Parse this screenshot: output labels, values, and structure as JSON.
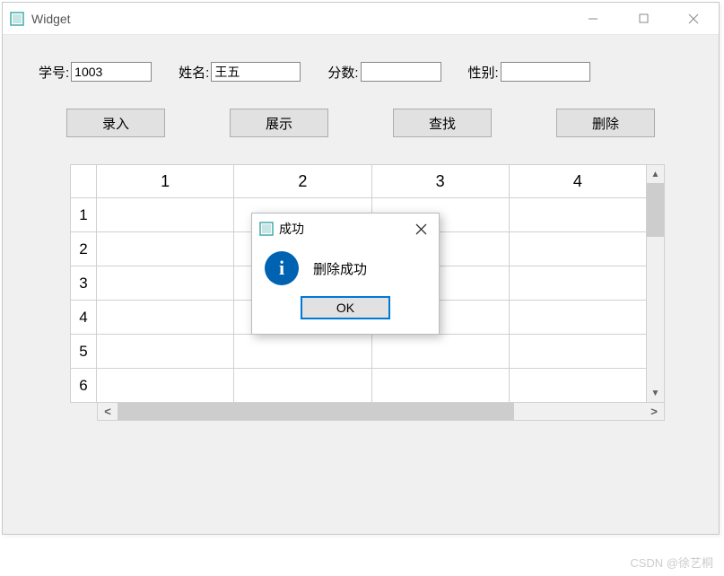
{
  "window": {
    "title": "Widget"
  },
  "form": {
    "student_id": {
      "label": "学号:",
      "value": "1003"
    },
    "name": {
      "label": "姓名:",
      "value": "王五"
    },
    "score": {
      "label": "分数:",
      "value": ""
    },
    "gender": {
      "label": "性别:",
      "value": ""
    }
  },
  "buttons": {
    "input": "录入",
    "show": "展示",
    "search": "查找",
    "delete": "删除"
  },
  "table": {
    "columns": [
      "1",
      "2",
      "3",
      "4"
    ],
    "rows": [
      "1",
      "2",
      "3",
      "4",
      "5",
      "6"
    ]
  },
  "dialog": {
    "title": "成功",
    "message": "删除成功",
    "ok": "OK",
    "info_glyph": "i"
  },
  "watermark": "CSDN @徐艺桐"
}
